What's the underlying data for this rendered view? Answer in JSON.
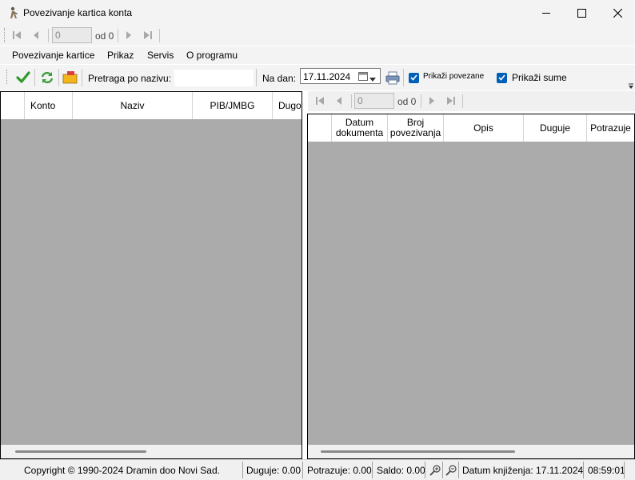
{
  "window": {
    "title": "Povezivanje kartica konta",
    "app_icon": "app-figure-icon",
    "controls": [
      "minimize-icon",
      "maximize-icon",
      "close-icon"
    ]
  },
  "top_navigator": {
    "position_value": "0",
    "of_label": "od 0",
    "buttons": [
      "first-record-icon",
      "previous-record-icon",
      "next-record-icon",
      "last-record-icon"
    ]
  },
  "menu": {
    "items": [
      "Povezivanje kartice",
      "Prikaz",
      "Servis",
      "O programu"
    ]
  },
  "toolbar": {
    "buttons": [
      "checkmark-icon",
      "refresh-icon",
      "open-folder-icon",
      "print-icon"
    ],
    "search_label": "Pretraga po nazivu:",
    "search_value": "",
    "date_label": "Na dan:",
    "date_value": "17.11.2024",
    "show_linked_label": "Prikaži povezane",
    "show_linked_checked": true,
    "show_sums_label": "Prikaži sume",
    "show_sums_checked": true
  },
  "left_grid": {
    "columns": [
      "",
      "Konto",
      "Naziv",
      "PIB/JMBG",
      "Dugov"
    ],
    "rows": []
  },
  "right_navigator": {
    "position_value": "0",
    "of_label": "od 0"
  },
  "right_grid": {
    "columns": [
      "",
      "Datum\ndokumenta",
      "Broj\npovezivanja",
      "Opis",
      "Duguje",
      "Potrazuje"
    ],
    "rows": []
  },
  "statusbar": {
    "copyright": "Copyright © 1990-2024 Dramin doo Novi Sad.",
    "debit": "Duguje: 0.00",
    "credit": "Potrazuje: 0.00",
    "balance": "Saldo: 0.00",
    "posting_date": "Datum knjiženja: 17.11.2024",
    "time": "08:59:01",
    "icons": [
      "zoom-in-icon",
      "zoom-out-icon"
    ]
  },
  "colors": {
    "grid_background": "#ababab",
    "checkbox_accent": "#005fb8",
    "chrome_background": "#f3f3f3"
  }
}
